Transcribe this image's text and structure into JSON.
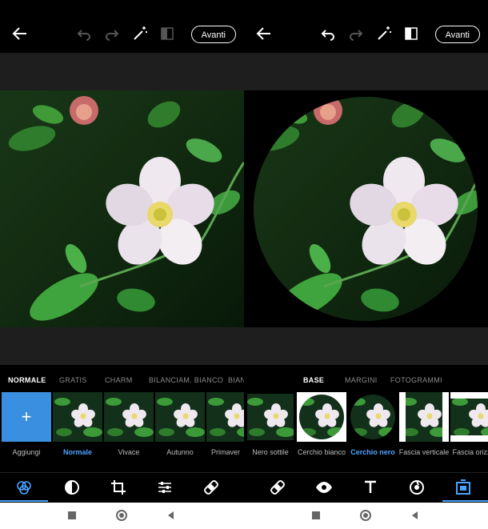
{
  "left_panel": {
    "topbar": {
      "next_label": "Avanti"
    },
    "tabs": [
      "NORMALE",
      "GRATIS",
      "CHARM",
      "BILANCIAM. BIANCO",
      "BIAN"
    ],
    "thumbnails": [
      "Aggiungi",
      "Normale",
      "Vivace",
      "Autunno",
      "Primaver"
    ],
    "active_thumbnail": "Normale",
    "tools": [
      "filters-icon",
      "adjust-circle-icon",
      "crop-icon",
      "sliders-icon",
      "healing-bandage-icon"
    ]
  },
  "right_panel": {
    "topbar": {
      "next_label": "Avanti"
    },
    "tabs": [
      "BASE",
      "MARGINI",
      "FOTOGRAMMI"
    ],
    "thumbnails": [
      "Nero sottile",
      "Cerchio bianco",
      "Cerchio nero",
      "Fascia verticale",
      "Fascia orizzo"
    ],
    "active_thumbnail": "Cerchio nero",
    "tools": [
      "healing-bandage-icon",
      "eye-icon",
      "text-icon",
      "sticker-icon",
      "frame-icon"
    ]
  },
  "icons": {
    "add_tile": "+",
    "back": "back-arrow-icon",
    "undo": "undo-icon",
    "redo": "redo-icon",
    "magic": "magic-wand-icon",
    "compare": "compare-icon"
  },
  "colors": {
    "accent": "#4aa3ff",
    "add_tile_bg": "#3a8fe0"
  }
}
